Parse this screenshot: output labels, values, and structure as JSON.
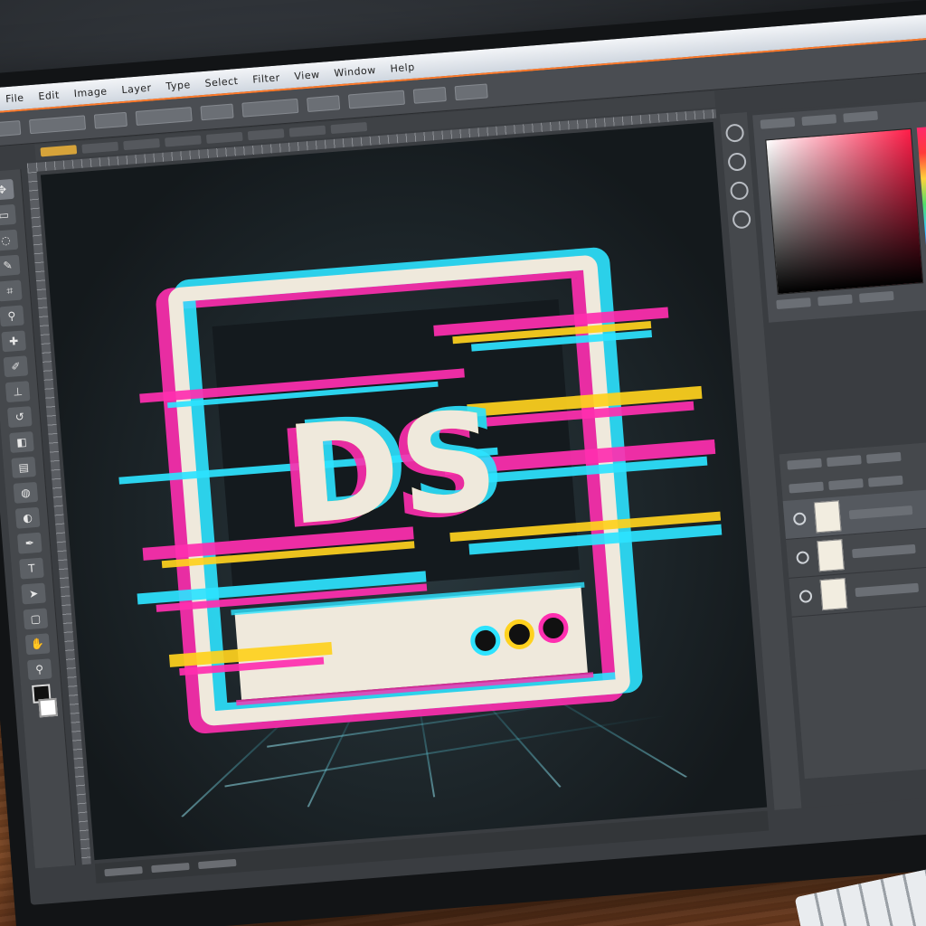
{
  "app": {
    "menus": [
      "File",
      "Edit",
      "Image",
      "Layer",
      "Type",
      "Select",
      "Filter",
      "View",
      "Window",
      "Help"
    ]
  },
  "artwork": {
    "logo_text": "DS"
  },
  "colors": {
    "accent_orange": "#ff7a2a",
    "glitch_magenta": "#ff2fb0",
    "glitch_cyan": "#2de3ff",
    "glitch_yellow": "#ffd21e",
    "card_fill": "#efe9dc",
    "picker_red": "#ff1d48"
  },
  "icons": {
    "toolbar": [
      "move-icon",
      "marquee-icon",
      "lasso-icon",
      "quick-select-icon",
      "crop-icon",
      "eyedropper-icon",
      "healing-icon",
      "brush-icon",
      "stamp-icon",
      "history-brush-icon",
      "eraser-icon",
      "gradient-icon",
      "blur-icon",
      "dodge-icon",
      "pen-icon",
      "type-icon",
      "path-select-icon",
      "shape-icon",
      "hand-icon",
      "zoom-icon"
    ]
  }
}
